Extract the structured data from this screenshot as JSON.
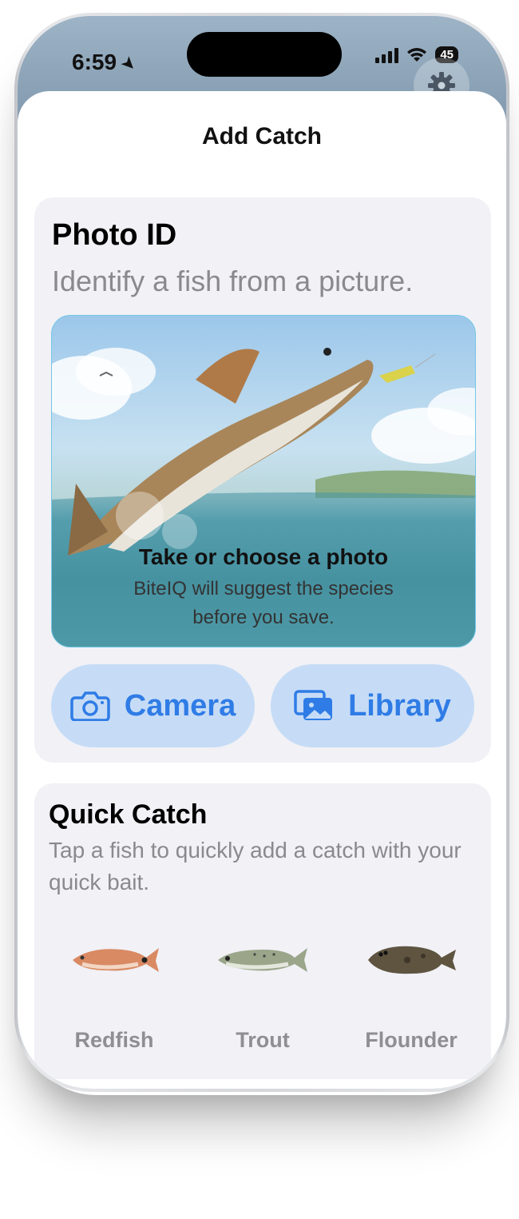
{
  "status_bar": {
    "time": "6:59",
    "battery": "45"
  },
  "sheet": {
    "title": "Add Catch"
  },
  "photo_id": {
    "title": "Photo ID",
    "subtitle": "Identify a fish from a picture.",
    "caption_title": "Take or choose a photo",
    "caption_line1": "BiteIQ will suggest the species",
    "caption_line2": "before you save.",
    "camera_label": "Camera",
    "library_label": "Library"
  },
  "quick_catch": {
    "title": "Quick Catch",
    "subtitle": "Tap a fish to quickly add a catch with your quick bait.",
    "fish": [
      {
        "label": "Redfish",
        "icon": "redfish-icon"
      },
      {
        "label": "Trout",
        "icon": "trout-icon"
      },
      {
        "label": "Flounder",
        "icon": "flounder-icon"
      }
    ]
  },
  "colors": {
    "accent": "#2f7ce6",
    "button_bg": "#c6dcf6",
    "card_bg": "#f1f1f6"
  }
}
